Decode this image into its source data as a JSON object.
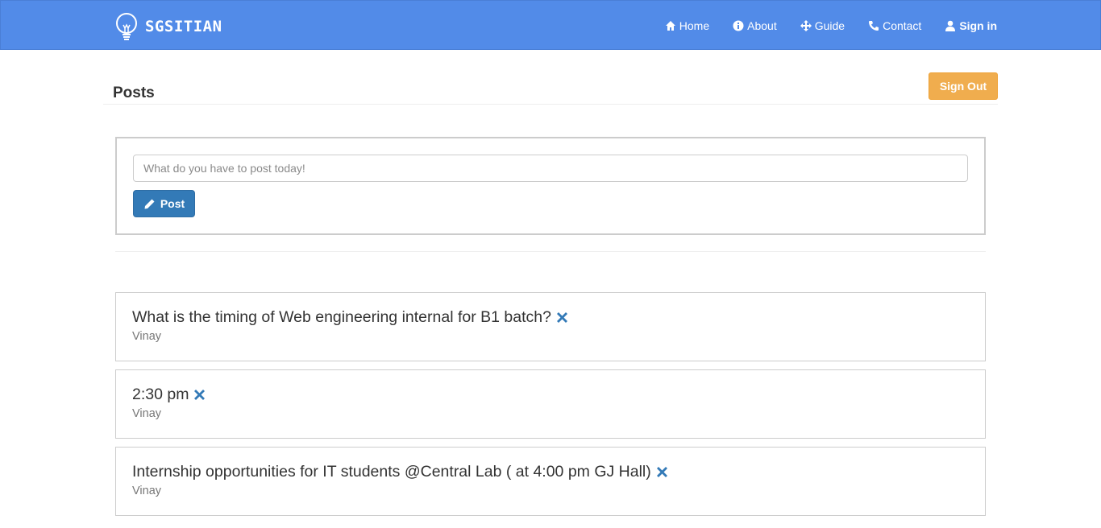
{
  "brand": {
    "name": "SGSITIAN",
    "icon": "lightbulb-icon"
  },
  "nav": {
    "items": [
      {
        "label": "Home",
        "icon": "home-icon"
      },
      {
        "label": "About",
        "icon": "info-icon"
      },
      {
        "label": "Guide",
        "icon": "move-arrows-icon"
      },
      {
        "label": "Contact",
        "icon": "phone-icon"
      },
      {
        "label": "Sign in",
        "icon": "user-icon"
      }
    ]
  },
  "header": {
    "title": "Posts",
    "signout_label": "Sign Out"
  },
  "composer": {
    "placeholder": "What do you have to post today!",
    "value": "",
    "button_label": "Post",
    "button_icon": "pencil-icon"
  },
  "posts": [
    {
      "text": "What is the timing of Web engineering internal for B1 batch?",
      "author": "Vinay"
    },
    {
      "text": "2:30 pm",
      "author": "Vinay"
    },
    {
      "text": "Internship opportunities for IT students @Central Lab ( at 4:00 pm GJ Hall)",
      "author": "Vinay"
    }
  ],
  "colors": {
    "navbar": "#528be8",
    "primary": "#337ab7",
    "warning": "#f0ad4e",
    "delete_icon": "#337ab7"
  }
}
